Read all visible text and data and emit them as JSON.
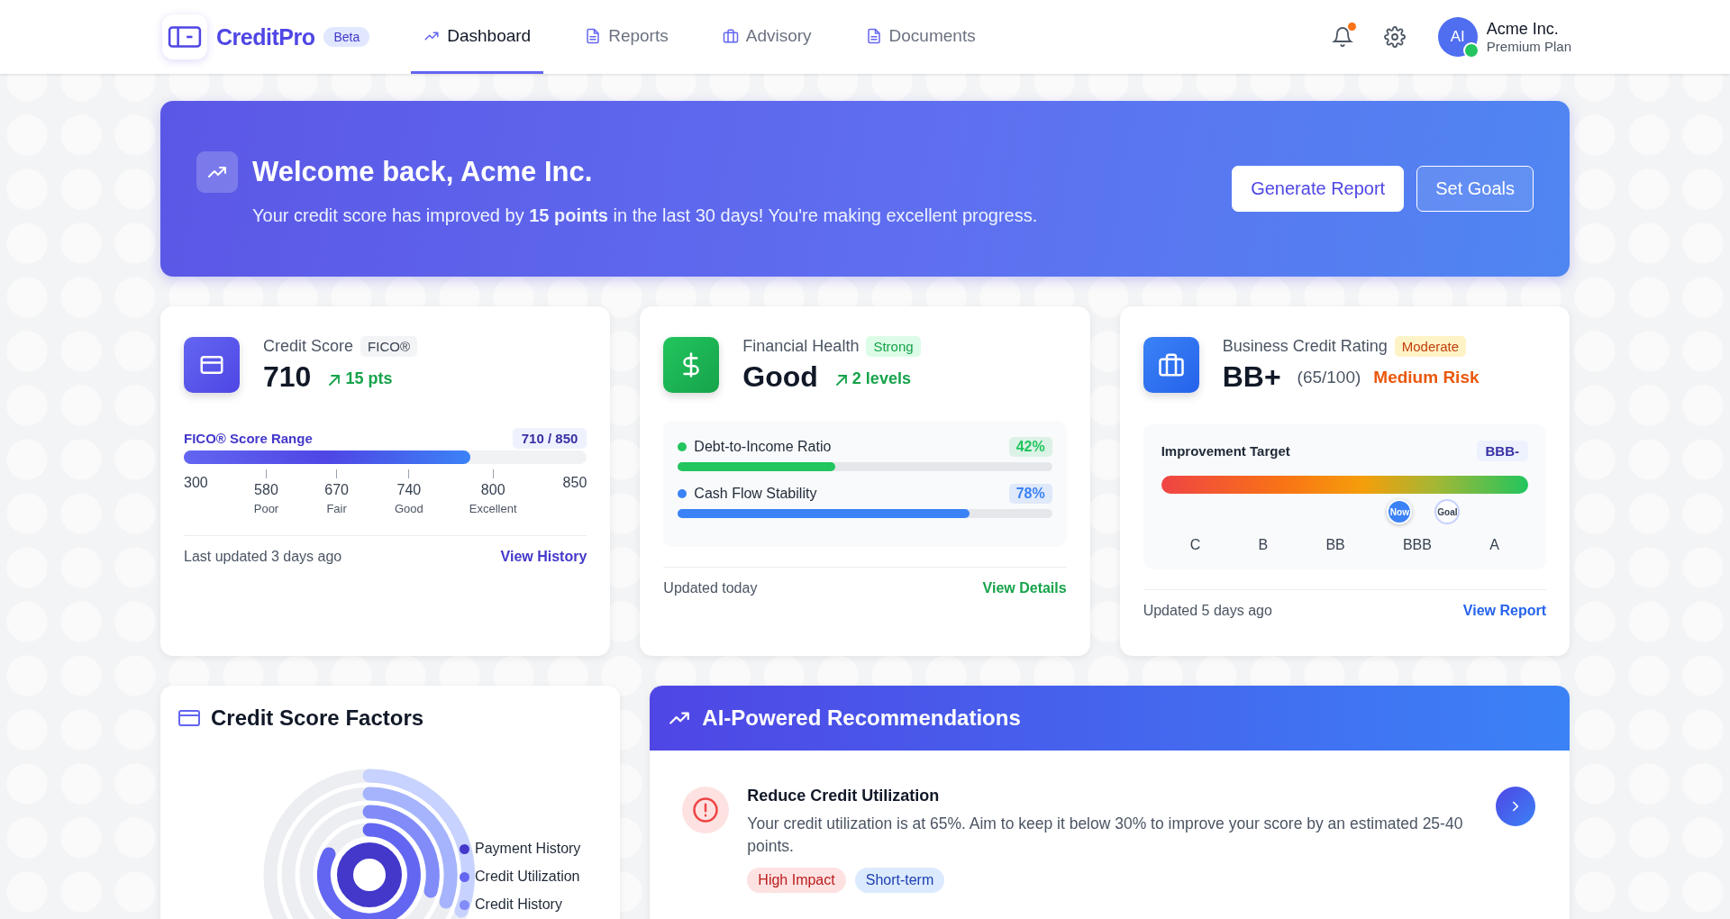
{
  "brand": {
    "name": "CreditPro",
    "badge": "Beta"
  },
  "nav": [
    {
      "label": "Dashboard",
      "kind": "trend",
      "selected": true
    },
    {
      "label": "Reports",
      "kind": "doc",
      "selected": false
    },
    {
      "label": "Advisory",
      "kind": "briefcase",
      "selected": false
    },
    {
      "label": "Documents",
      "kind": "doc",
      "selected": false
    }
  ],
  "user": {
    "notifications": true,
    "initials": "AI",
    "online": true,
    "name": "Acme Inc.",
    "plan": "Premium Plan"
  },
  "banner": {
    "title": "Welcome back, Acme Inc.",
    "text": "Your credit score has improved by **15 points** in the last 30 days! You're making excellent progress.",
    "buttons": [
      {
        "label": "Generate Report",
        "kind": "primary"
      },
      {
        "label": "Set Goals",
        "kind": "outline"
      }
    ]
  },
  "cards": [
    {
      "kind": "score",
      "title": "Credit Score",
      "badge": "FICO®",
      "value": "710",
      "change": "15 pts",
      "range": {
        "label": "FICO® Score Range",
        "reading": "710 / 850",
        "level": 0.71,
        "min": "300",
        "max": "850",
        "ticks": [
          {
            "value": "580",
            "label": "Poor"
          },
          {
            "value": "670",
            "label": "Fair"
          },
          {
            "value": "740",
            "label": "Good"
          },
          {
            "value": "800",
            "label": "Excellent"
          }
        ]
      },
      "updated": "Last updated 3 days ago",
      "link": "View History"
    },
    {
      "kind": "health",
      "title": "Financial Health",
      "badge": "Strong",
      "value": "Good",
      "change": "2 levels",
      "metrics": [
        {
          "label": "Debt-to-Income Ratio",
          "reading": "42%",
          "level": 0.42,
          "color": "#22c55e"
        },
        {
          "label": "Cash Flow Stability",
          "reading": "78%",
          "level": 0.78,
          "color": "#3b82f6"
        }
      ],
      "updated": "Updated today",
      "link": "View Details"
    },
    {
      "kind": "business",
      "title": "Business Credit Rating",
      "badge": "Moderate",
      "value": "BB+",
      "sub": "(65/100)",
      "risk": "Medium Risk",
      "target": {
        "label": "Improvement Target",
        "reading": "BBB-",
        "markers": [
          {
            "label": "Now",
            "kind": "current",
            "level": 0.65
          },
          {
            "label": "Goal",
            "kind": "goal",
            "level": 0.78
          }
        ],
        "grades": [
          "C",
          "B",
          "BB",
          "BBB",
          "A"
        ]
      },
      "updated": "Updated 5 days ago",
      "link": "View Report"
    }
  ],
  "factors": {
    "title": "Credit Score Factors",
    "legend": [
      {
        "label": "Payment History",
        "color": "#4338ca"
      },
      {
        "label": "Credit Utilization",
        "color": "#6366f1"
      },
      {
        "label": "Credit History",
        "color": "#818cf8"
      }
    ]
  },
  "recommendations": {
    "title": "AI-Powered Recommendations",
    "items": [
      {
        "title": "Reduce Credit Utilization",
        "text": "Your credit utilization is at 65%. Aim to keep it below 30% to improve your score by an estimated 25-40 points.",
        "tags": [
          {
            "label": "High Impact",
            "kind": "impact"
          },
          {
            "label": "Short-term",
            "kind": "term"
          }
        ]
      }
    ]
  }
}
